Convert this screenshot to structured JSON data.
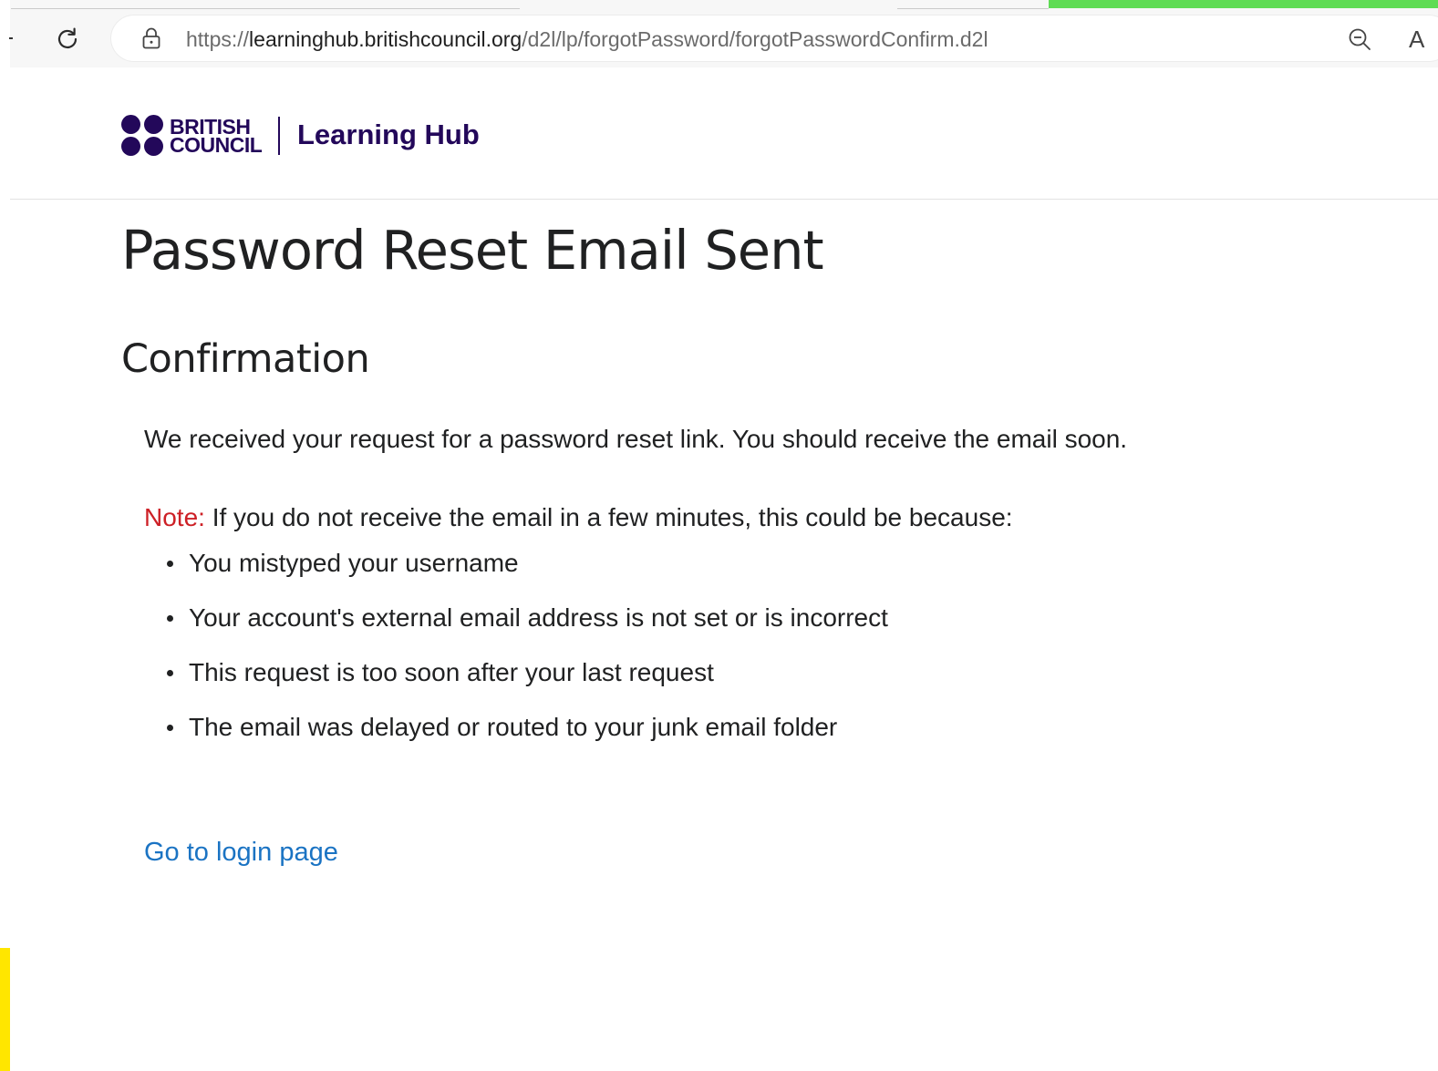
{
  "browser": {
    "url_protocol": "https://",
    "url_host": "learninghub.britishcouncil.org",
    "url_path": "/d2l/lp/forgotPassword/forgotPasswordConfirm.d2l",
    "readaloud_glyph": "A",
    "accent_color": "#5fdc54"
  },
  "header": {
    "logo_line1": "BRITISH",
    "logo_line2": "COUNCIL",
    "hub_name": "Learning Hub",
    "brand_color": "#23085a"
  },
  "main": {
    "title": "Password Reset Email Sent",
    "section_heading": "Confirmation",
    "confirmation_message": "We received your request for a password reset link. You should receive the email soon.",
    "note_label": "Note:",
    "note_text": " If you do not receive the email in a few minutes, this could be because:",
    "note_color": "#cd2026",
    "reasons": [
      "You mistyped your username",
      "Your account's external email address is not set or is incorrect",
      "This request is too soon after your last request",
      "The email was delayed or routed to your junk email folder"
    ],
    "login_link": "Go to login page",
    "link_color": "#1a73c3"
  },
  "icons": {
    "reload": "reload-icon",
    "lock": "lock-icon",
    "zoom": "zoom-out-icon",
    "read_aloud": "read-aloud-icon"
  }
}
